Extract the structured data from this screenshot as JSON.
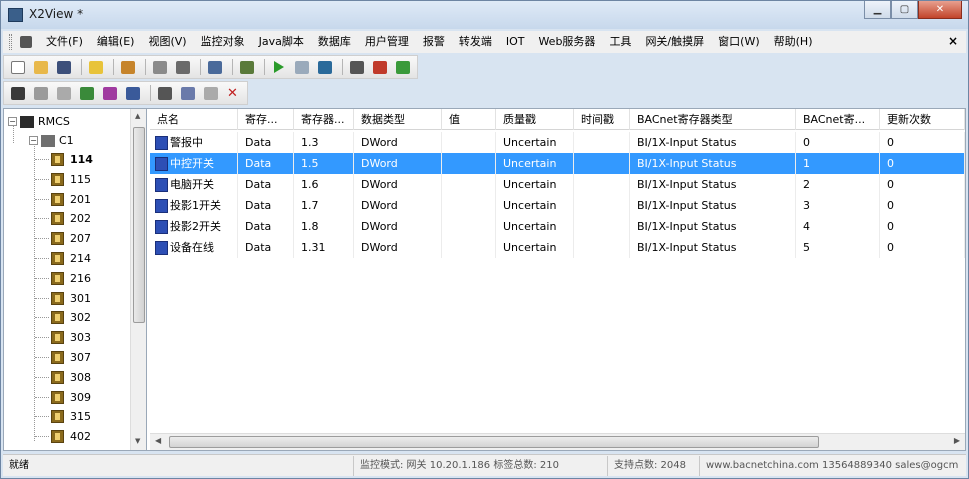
{
  "window": {
    "title": "X2View *",
    "controls": [
      "▁",
      "▢",
      "✕"
    ]
  },
  "menu": {
    "items": [
      "文件(F)",
      "编辑(E)",
      "视图(V)",
      "监控对象",
      "Java脚本",
      "数据库",
      "用户管理",
      "报警",
      "转发端",
      "IOT",
      "Web服务器",
      "工具",
      "网关/触摸屏",
      "窗口(W)",
      "帮助(H)"
    ],
    "close_glyph": "×"
  },
  "toolbar1": {
    "icons": [
      "new-file-icon",
      "open-folder-icon",
      "save-icon",
      "sep",
      "bulb-icon",
      "sep",
      "up-arrow-icon",
      "sep",
      "device-icon",
      "device2-icon",
      "sep",
      "config-icon",
      "sep",
      "script-icon",
      "sep",
      "run-icon",
      "stop-icon",
      "refresh-icon",
      "sep",
      "tools-icon",
      "ports-icon",
      "transfer-icon"
    ]
  },
  "toolbar2": {
    "icons": [
      "grid-icon",
      "link-icon",
      "table-icon",
      "folder-add-icon",
      "db-icon",
      "window-icon",
      "sep",
      "cut-icon",
      "copy-icon",
      "paste-icon",
      "delete-icon"
    ]
  },
  "tree": {
    "root": "RMCS",
    "channel": "C1",
    "nodes": [
      "114",
      "115",
      "201",
      "202",
      "207",
      "214",
      "216",
      "301",
      "302",
      "303",
      "307",
      "308",
      "309",
      "315",
      "402"
    ],
    "selected": "114"
  },
  "table": {
    "columns": [
      "点名",
      "寄存...",
      "寄存器...",
      "数据类型",
      "值",
      "质量戳",
      "时间戳",
      "BACnet寄存器类型",
      "BACnet寄...",
      "更新次数"
    ],
    "rows": [
      {
        "name": "警报中",
        "reg": "Data",
        "addr": "1.3",
        "type": "DWord",
        "value": "",
        "quality": "Uncertain",
        "time": "",
        "bacnet_type": "BI/1X-Input Status",
        "bacnet_idx": "0",
        "updates": "0"
      },
      {
        "name": "中控开关",
        "reg": "Data",
        "addr": "1.5",
        "type": "DWord",
        "value": "",
        "quality": "Uncertain",
        "time": "",
        "bacnet_type": "BI/1X-Input Status",
        "bacnet_idx": "1",
        "updates": "0"
      },
      {
        "name": "电脑开关",
        "reg": "Data",
        "addr": "1.6",
        "type": "DWord",
        "value": "",
        "quality": "Uncertain",
        "time": "",
        "bacnet_type": "BI/1X-Input Status",
        "bacnet_idx": "2",
        "updates": "0"
      },
      {
        "name": "投影1开关",
        "reg": "Data",
        "addr": "1.7",
        "type": "DWord",
        "value": "",
        "quality": "Uncertain",
        "time": "",
        "bacnet_type": "BI/1X-Input Status",
        "bacnet_idx": "3",
        "updates": "0"
      },
      {
        "name": "投影2开关",
        "reg": "Data",
        "addr": "1.8",
        "type": "DWord",
        "value": "",
        "quality": "Uncertain",
        "time": "",
        "bacnet_type": "BI/1X-Input Status",
        "bacnet_idx": "4",
        "updates": "0"
      },
      {
        "name": "设备在线",
        "reg": "Data",
        "addr": "1.31",
        "type": "DWord",
        "value": "",
        "quality": "Uncertain",
        "time": "",
        "bacnet_type": "BI/1X-Input Status",
        "bacnet_idx": "5",
        "updates": "0"
      }
    ],
    "selected_row": 1
  },
  "status": {
    "left": "就绪",
    "mode": "监控模式: 网关 10.20.1.186 标签总数: 210",
    "points": "支持点数: 2048",
    "site": "www.bacnetchina.com 13564889340 sales@ogcm"
  }
}
